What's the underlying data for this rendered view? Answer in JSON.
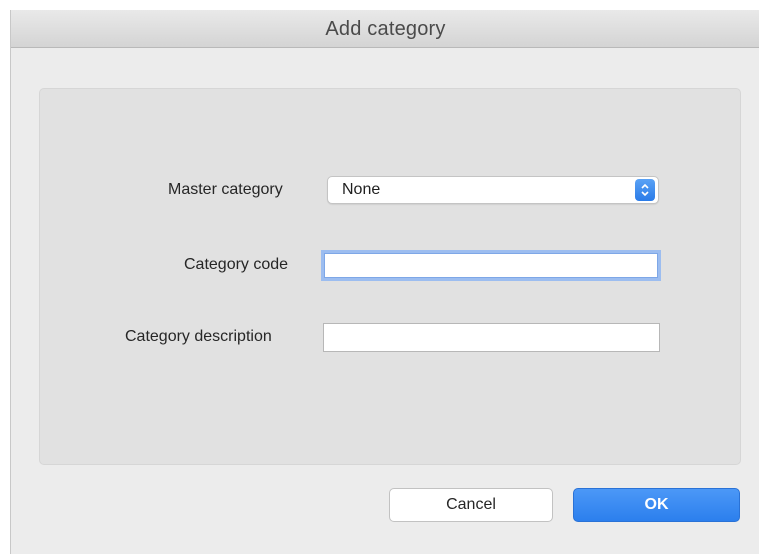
{
  "dialog": {
    "title": "Add category"
  },
  "form": {
    "master_category_label": "Master category",
    "master_category_value": "None",
    "category_code_label": "Category code",
    "category_code_value": "",
    "category_description_label": "Category description",
    "category_description_value": ""
  },
  "buttons": {
    "cancel": "Cancel",
    "ok": "OK"
  },
  "colors": {
    "accent": "#2c7fed",
    "focus_ring": "#9cbdf0"
  },
  "icons": {
    "select_arrows": "chevron-up-down-icon"
  }
}
